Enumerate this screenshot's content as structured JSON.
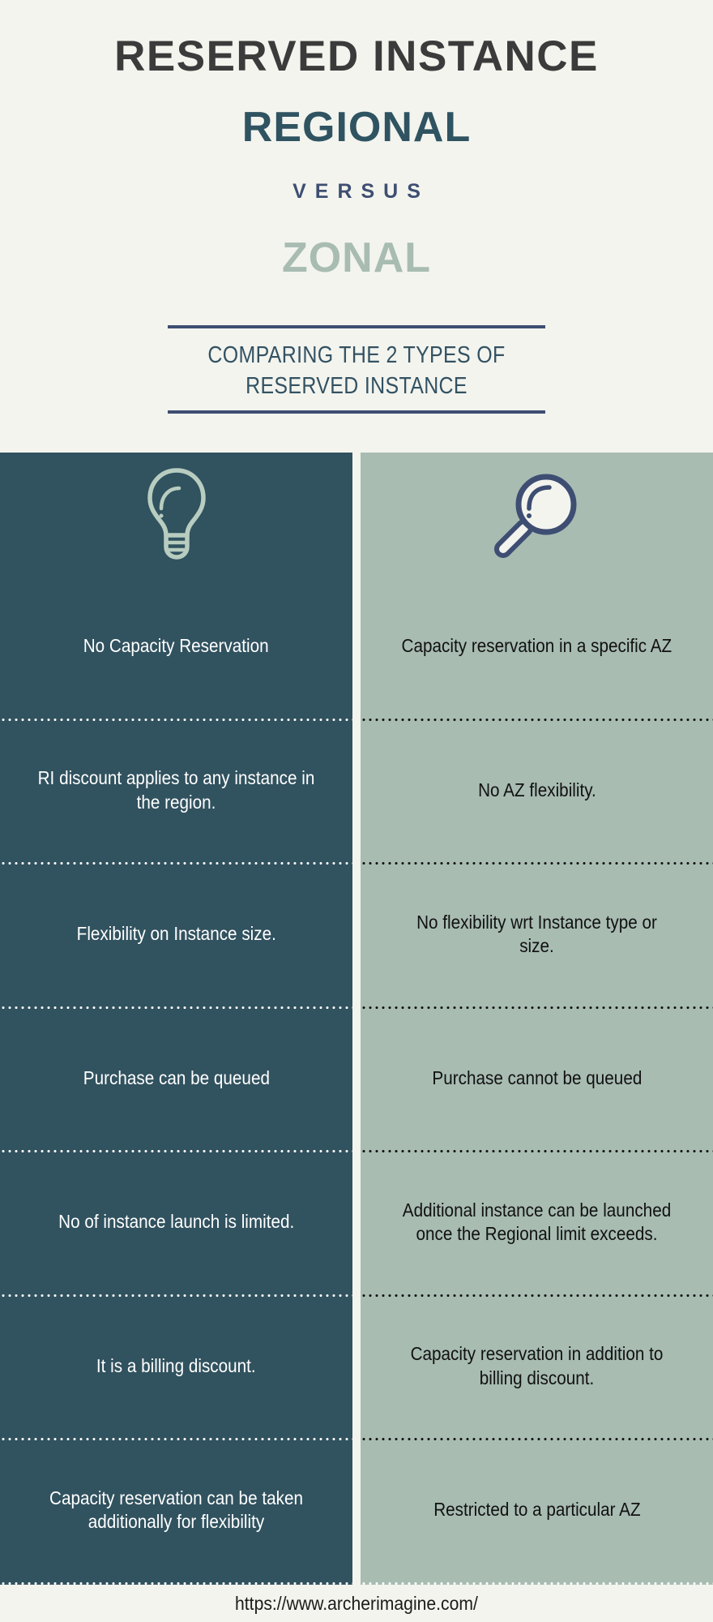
{
  "header": {
    "title_main": "RESERVED INSTANCE",
    "title_regional": "REGIONAL",
    "title_versus": "VERSUS",
    "title_zonal": "ZONAL",
    "subtitle": "COMPARING THE 2 TYPES OF RESERVED INSTANCE"
  },
  "colors": {
    "background": "#f3f4ee",
    "title_main": "#3b3b3b",
    "regional": "#2f5361",
    "versus": "#3e4e72",
    "zonal": "#a8bcb2",
    "rule": "#3e4e72",
    "subtitle": "#335263",
    "left_panel": "#31525f",
    "right_panel": "#a8bcb2",
    "left_text": "#ffffff",
    "right_text": "#111111"
  },
  "comparison": {
    "left": {
      "icon": "lightbulb-icon",
      "rows": [
        "No Capacity Reservation",
        "RI discount applies to any instance in the region.",
        "Flexibility on Instance size.",
        "Purchase can be queued",
        "No of instance launch is limited.",
        "It is a billing discount.",
        "Capacity reservation can be taken additionally for flexibility"
      ]
    },
    "right": {
      "icon": "magnifier-icon",
      "rows": [
        "Capacity reservation in a specific AZ",
        "No AZ flexibility.",
        "No flexibility wrt Instance type or size.",
        "Purchase cannot be queued",
        "Additional instance can be launched once the Regional limit exceeds.",
        "Capacity reservation in addition to billing discount.",
        "Restricted to a particular AZ"
      ]
    }
  },
  "footer": {
    "url": "https://www.archerimagine.com/"
  }
}
